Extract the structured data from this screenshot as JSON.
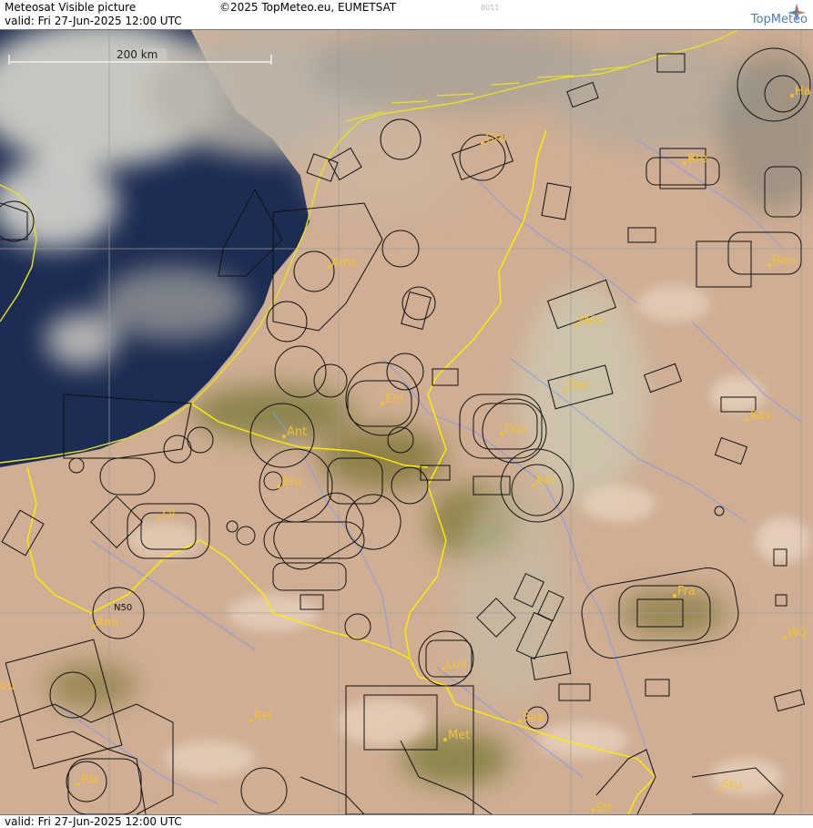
{
  "header": {
    "title": "Meteosat Visible picture",
    "valid": "valid:  Fri  27-Jun-2025  12:00 UTC",
    "copyright": "©2025 TopMeteo.eu, EUMETSAT",
    "code": "8011",
    "brand": "TopMeteo"
  },
  "footer": {
    "valid": "valid:  Fri  27-Jun-2025  12:00 UTC"
  },
  "scale": {
    "label": "200 km"
  },
  "grid_label": "N50",
  "colors": {
    "border": "#ffee00",
    "coast": "#e6e22a",
    "rivers": "#8a9ae6",
    "city": "#f3c233",
    "sea": "#1c2c52"
  },
  "cities": [
    {
      "name": "Gro"
    },
    {
      "name": "Bre"
    },
    {
      "name": "Ha"
    },
    {
      "name": "Ams"
    },
    {
      "name": "Han"
    },
    {
      "name": "Mün"
    },
    {
      "name": "Ein"
    },
    {
      "name": "Dor"
    },
    {
      "name": "Ant"
    },
    {
      "name": "Düs"
    },
    {
      "name": "Kas"
    },
    {
      "name": "Bru"
    },
    {
      "name": "Köl"
    },
    {
      "name": "Lil"
    },
    {
      "name": "Fra"
    },
    {
      "name": "Ami"
    },
    {
      "name": "Wü"
    },
    {
      "name": "Lux"
    },
    {
      "name": "ou"
    },
    {
      "name": "Rei"
    },
    {
      "name": "Saa"
    },
    {
      "name": "Met"
    },
    {
      "name": "Par"
    },
    {
      "name": "Stu"
    },
    {
      "name": "Str"
    }
  ]
}
